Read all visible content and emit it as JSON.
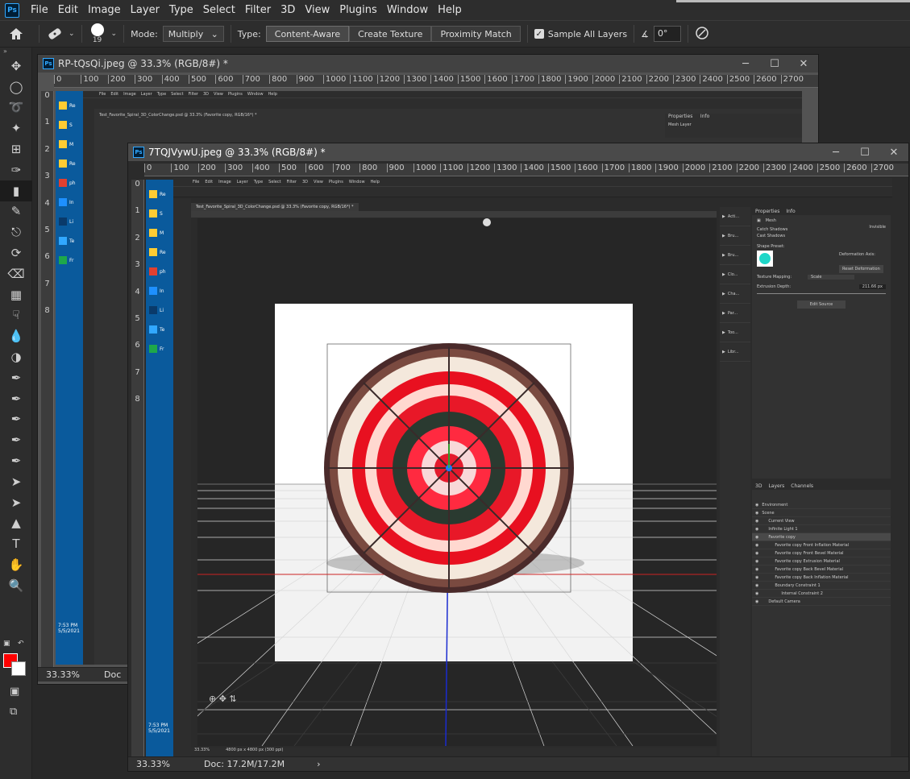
{
  "app": {
    "logo": "Ps"
  },
  "menu": [
    "File",
    "Edit",
    "Image",
    "Layer",
    "Type",
    "Select",
    "Filter",
    "3D",
    "View",
    "Plugins",
    "Window",
    "Help"
  ],
  "options": {
    "brush_size": "19",
    "mode_label": "Mode:",
    "mode_value": "Multiply",
    "type_label": "Type:",
    "type_buttons": [
      "Content-Aware",
      "Create Texture",
      "Proximity Match"
    ],
    "sample_all_layers": "Sample All Layers",
    "angle_value": "0°"
  },
  "back_window": {
    "title": "RP-tQsQi.jpeg @ 33.3% (RGB/8#) *",
    "zoom": "33.33%",
    "doc_prefix": "Doc",
    "ruler_top": [
      "0",
      "100",
      "200",
      "300",
      "400",
      "500",
      "600",
      "700",
      "800",
      "900",
      "1000",
      "1100",
      "1200",
      "1300",
      "1400",
      "1500",
      "1600",
      "1700",
      "1800",
      "1900",
      "2000",
      "2100",
      "2200",
      "2300",
      "2400",
      "2500",
      "2600",
      "2700"
    ],
    "ruler_left": [
      "0",
      "1",
      "2",
      "3",
      "4",
      "5",
      "6",
      "7",
      "8"
    ],
    "inner_tab": "Test_Favorite_Spiral_3D_ColorChange.psd @ 33.3% (Favorite copy, RGB/16*) *",
    "inner_panel_tabs": [
      "Properties",
      "Info"
    ],
    "inner_panel_item": "Mesh Layer",
    "taskbar_time": "7:53 PM",
    "taskbar_date": "5/5/2021",
    "taskbar_labels": [
      "Re",
      "S",
      "M",
      "Re",
      "ph",
      "In",
      "Li",
      "Te",
      "Fr"
    ]
  },
  "front_window": {
    "title": "7TQJVywU.jpeg @ 33.3% (RGB/8#) *",
    "zoom": "33.33%",
    "doc_size": "Doc: 17.2M/17.2M",
    "ruler_top": [
      "0",
      "100",
      "200",
      "300",
      "400",
      "500",
      "600",
      "700",
      "800",
      "900",
      "1000",
      "1100",
      "1200",
      "1300",
      "1400",
      "1500",
      "1600",
      "1700",
      "1800",
      "1900",
      "2000",
      "2100",
      "2200",
      "2300",
      "2400",
      "2500",
      "2600",
      "2700"
    ],
    "ruler_left": [
      "0",
      "1",
      "2",
      "3",
      "4",
      "5",
      "6",
      "7",
      "8"
    ],
    "taskbar_time": "7:53 PM",
    "taskbar_date": "5/5/2021",
    "taskbar_labels": [
      "Re",
      "S",
      "M",
      "Re",
      "ph",
      "In",
      "Li",
      "Te",
      "Fr"
    ],
    "inner": {
      "menu": [
        "File",
        "Edit",
        "Image",
        "Layer",
        "Type",
        "Select",
        "Filter",
        "3D",
        "View",
        "Plugins",
        "Window",
        "Help"
      ],
      "tab": "Test_Favorite_Spiral_3D_ColorChange.psd @ 33.3% (Favorite copy, RGB/16*) *",
      "zoom": "33.33%",
      "status": "4800 px x 4800 px (300 ppi)",
      "mini_panels": [
        "Acti...",
        "Bru...",
        "Bru...",
        "Clo...",
        "Cha...",
        "Par...",
        "Too...",
        "Libr..."
      ],
      "properties_tabs": [
        "Properties",
        "Info"
      ],
      "mesh_label": "Mesh",
      "catch_shadows": "Catch Shadows",
      "cast_shadows": "Cast Shadows",
      "invisible": "Invisible",
      "shape_preset": "Shape Preset:",
      "deformation_axis": "Deformation Axis:",
      "reset_deformation": "Reset Deformation",
      "texture_mapping_label": "Texture Mapping:",
      "texture_mapping_value": "Scale",
      "extrusion_label": "Extrusion Depth:",
      "extrusion_value": "211.66 px",
      "edit_source": "Edit Source",
      "layers_tabs": [
        "3D",
        "Layers",
        "Channels"
      ],
      "layers": [
        {
          "name": "Environment",
          "indent": 0,
          "sel": false
        },
        {
          "name": "Scene",
          "indent": 0,
          "sel": false
        },
        {
          "name": "Current View",
          "indent": 1,
          "sel": false
        },
        {
          "name": "Infinite Light 1",
          "indent": 1,
          "sel": false
        },
        {
          "name": "Favorite copy",
          "indent": 1,
          "sel": true
        },
        {
          "name": "Favorite copy Front Inflation Material",
          "indent": 2,
          "sel": false
        },
        {
          "name": "Favorite copy Front Bevel Material",
          "indent": 2,
          "sel": false
        },
        {
          "name": "Favorite copy Extrusion Material",
          "indent": 2,
          "sel": false
        },
        {
          "name": "Favorite copy Back Bevel Material",
          "indent": 2,
          "sel": false
        },
        {
          "name": "Favorite copy Back Inflation Material",
          "indent": 2,
          "sel": false
        },
        {
          "name": "Boundary Constraint 1",
          "indent": 2,
          "sel": false
        },
        {
          "name": "Internal Constraint 2",
          "indent": 3,
          "sel": false
        },
        {
          "name": "Default Camera",
          "indent": 1,
          "sel": false
        }
      ]
    }
  },
  "colors": {
    "foreground": "#ff0000",
    "background": "#ffffff",
    "accent": "#31a8ff"
  }
}
